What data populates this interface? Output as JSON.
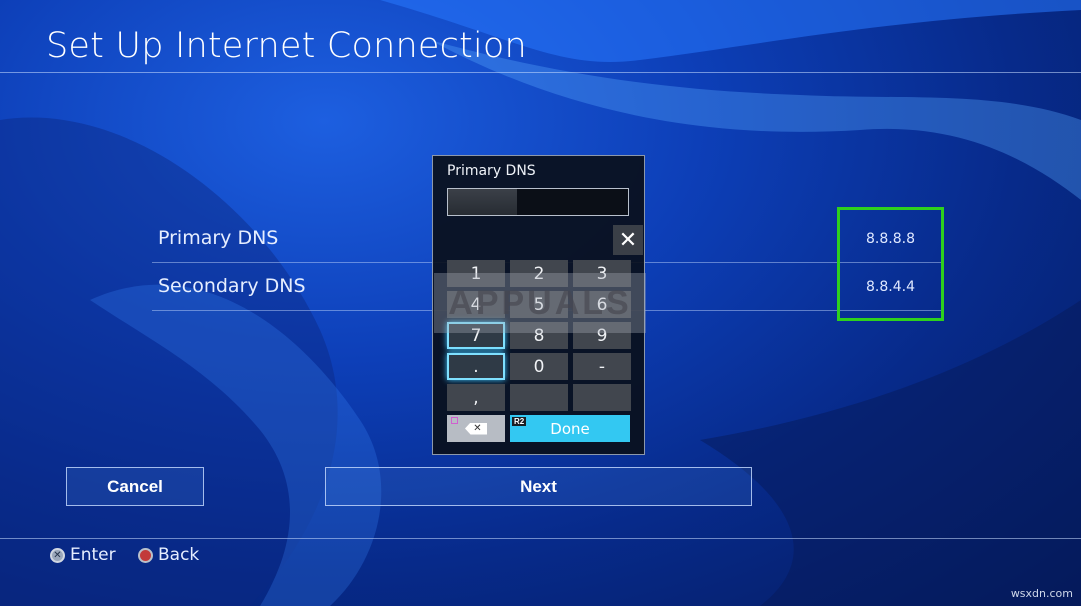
{
  "header": {
    "title": "Set Up Internet Connection"
  },
  "settings": [
    {
      "label": "Primary DNS",
      "value": "8.8.8.8"
    },
    {
      "label": "Secondary DNS",
      "value": "8.8.4.4"
    }
  ],
  "buttons": {
    "cancel": "Cancel",
    "next": "Next"
  },
  "footer": {
    "enter_label": "Enter",
    "back_label": "Back"
  },
  "keypad": {
    "title": "Primary DNS",
    "input_value": "",
    "close_glyph": "✕",
    "keys": [
      "1",
      "2",
      "3",
      "4",
      "5",
      "6",
      "7",
      "8",
      "9",
      ".",
      "0",
      "-",
      ","
    ],
    "done_label": "Done",
    "done_shortcut": "R2"
  },
  "watermark": "APPUALS",
  "corner_watermark": "wsxdn.com",
  "colors": {
    "highlight": "#2ed11d",
    "done": "#33c8f2",
    "selected_key_glow": "#7fe0ff"
  }
}
